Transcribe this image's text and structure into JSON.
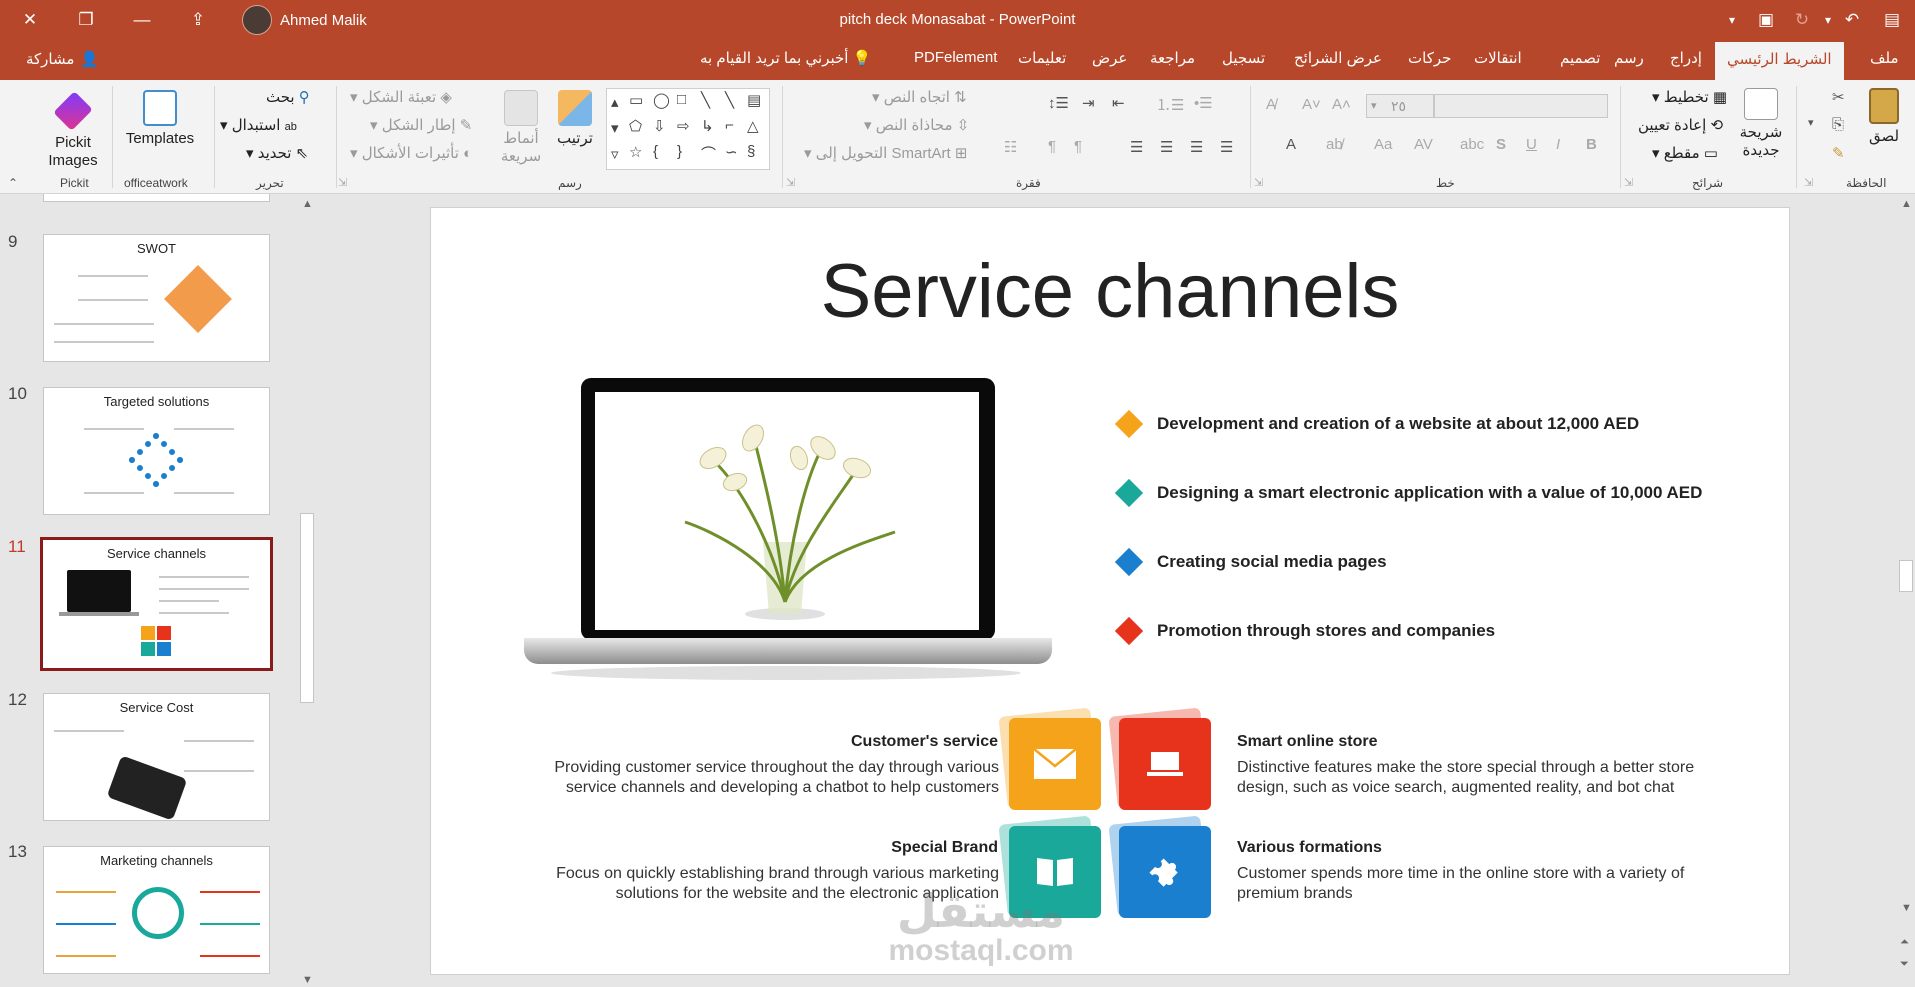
{
  "window": {
    "title": "pitch deck Monasabat  -  PowerPoint",
    "user": "Ahmed Malik"
  },
  "tabs": {
    "file": "ملف",
    "home": "الشريط الرئيسي",
    "insert": "إدراج",
    "draw": "رسم",
    "design": "تصميم",
    "transitions": "انتقالات",
    "animations": "حركات",
    "slideshow": "عرض الشرائح",
    "record": "تسجيل",
    "review": "مراجعة",
    "view": "عرض",
    "help": "تعليمات",
    "pdfelement": "PDFelement",
    "tell_me": "أخبرني بما تريد القيام به",
    "share": "مشاركة"
  },
  "ribbon": {
    "clipboard": {
      "paste": "لصق",
      "label": "الحافظة"
    },
    "slides": {
      "new_slide": "شريحة جديدة",
      "layout": "تخطيط",
      "reset": "إعادة تعيين",
      "section": "مقطع",
      "label": "شرائح"
    },
    "font": {
      "size": "٢٥",
      "label": "خط"
    },
    "paragraph": {
      "text_direction": "اتجاه النص",
      "align_text": "محاذاة النص",
      "smartart": "التحويل إلى SmartArt",
      "label": "فقرة"
    },
    "drawing": {
      "arrange": "ترتيب",
      "quick_styles": "أنماط سريعة",
      "shape_fill": "تعبئة الشكل",
      "shape_outline": "إطار الشكل",
      "shape_effects": "تأثيرات الأشكال",
      "label": "رسم"
    },
    "editing": {
      "find": "بحث",
      "replace": "استبدال",
      "select": "تحديد",
      "label": "تحرير"
    },
    "officeatwork": {
      "templates": "Templates",
      "label": "officeatwork"
    },
    "pickit": {
      "images": "Pickit Images",
      "label": "Pickit"
    }
  },
  "thumbnails": [
    {
      "num": "9",
      "title": "SWOT"
    },
    {
      "num": "10",
      "title": "Targeted solutions"
    },
    {
      "num": "11",
      "title": "Service channels"
    },
    {
      "num": "12",
      "title": "Service Cost"
    },
    {
      "num": "13",
      "title": "Marketing channels"
    }
  ],
  "slide": {
    "title": "Service channels",
    "bullets": [
      {
        "text": "Development and creation of a website at about 12,000 AED",
        "color": "#f5a31a"
      },
      {
        "text": "Designing a smart electronic application with a value of 10,000 AED",
        "color": "#1aa89a"
      },
      {
        "text": "Creating social media pages",
        "color": "#1a7fcf"
      },
      {
        "text": "Promotion through stores and companies",
        "color": "#e8331c"
      }
    ],
    "features": {
      "customer_service": {
        "title": "Customer's service",
        "desc": "Providing customer service throughout the day through various service channels and developing a chatbot to help customers"
      },
      "online_store": {
        "title": "Smart online store",
        "desc": "Distinctive features make the store special through a better store design, such as voice search, augmented reality, and bot chat"
      },
      "special_brand": {
        "title": "Special Brand",
        "desc": "Focus on quickly establishing brand through various marketing solutions for the website and the electronic application"
      },
      "formations": {
        "title": "Various formations",
        "desc": "Customer spends more time in the online store with a variety of premium brands"
      }
    },
    "watermark": {
      "arabic": "مستقل",
      "latin": "mostaql.com"
    }
  }
}
